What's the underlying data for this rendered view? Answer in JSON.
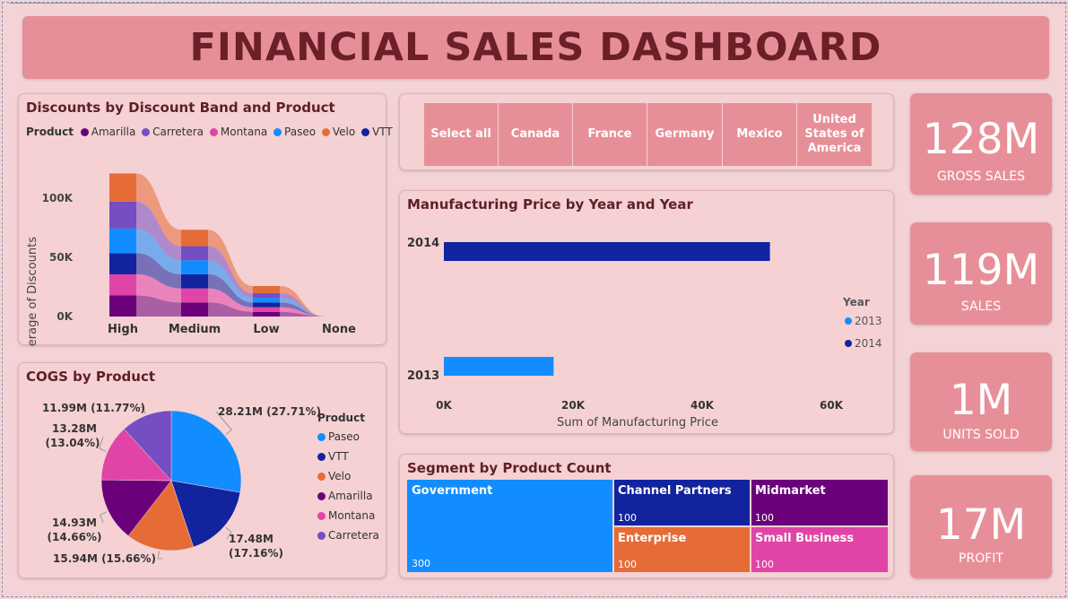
{
  "header": {
    "title": "FINANCIAL SALES DASHBOARD"
  },
  "colors": {
    "Paseo": "#118dff",
    "VTT": "#12239e",
    "Velo": "#e66c37",
    "Amarilla": "#6b007b",
    "Montana": "#e044a7",
    "Carretera": "#744ec2"
  },
  "discounts": {
    "title": "Discounts by Discount Band and Product",
    "legend_title": "Product",
    "legend": [
      "Amarilla",
      "Carretera",
      "Montana",
      "Paseo",
      "Velo",
      "VTT"
    ],
    "ylabel": "Average of Discounts",
    "yticks": [
      "0K",
      "50K",
      "100K"
    ],
    "categories": [
      "High",
      "Medium",
      "Low",
      "None"
    ]
  },
  "cogs": {
    "title": "COGS by Product",
    "legend_title": "Product",
    "legend": [
      "Paseo",
      "VTT",
      "Velo",
      "Amarilla",
      "Montana",
      "Carretera"
    ],
    "labels": {
      "paseo": "28.21M (27.71%)",
      "vtt_value": "17.48M",
      "vtt_pct": "(17.16%)",
      "velo": "15.94M (15.66%)",
      "amarilla_value": "14.93M",
      "amarilla_pct": "(14.66%)",
      "montana_value": "13.28M",
      "montana_pct": "(13.04%)",
      "carretera": "11.99M (11.77%)"
    }
  },
  "slicer": {
    "items": [
      "Select all",
      "Canada",
      "France",
      "Germany",
      "Mexico",
      "United States of America"
    ]
  },
  "manufacturing": {
    "title": "Manufacturing Price by Year and Year",
    "xlabel": "Sum of Manufacturing Price",
    "xticks": [
      "0K",
      "20K",
      "40K",
      "60K"
    ],
    "legend_title": "Year",
    "legend": [
      "2013",
      "2014"
    ],
    "years": [
      "2014",
      "2013"
    ]
  },
  "segment": {
    "title": "Segment by Product Count",
    "tiles": [
      {
        "name": "Government",
        "count": "300"
      },
      {
        "name": "Channel Partners",
        "count": "100"
      },
      {
        "name": "Midmarket",
        "count": "100"
      },
      {
        "name": "Enterprise",
        "count": "100"
      },
      {
        "name": "Small Business",
        "count": "100"
      }
    ]
  },
  "kpis": [
    {
      "value": "128M",
      "label": "GROSS SALES"
    },
    {
      "value": "119M",
      "label": "SALES"
    },
    {
      "value": "1M",
      "label": "UNITS SOLD"
    },
    {
      "value": "17M",
      "label": "PROFIT"
    }
  ],
  "chart_data": [
    {
      "type": "area",
      "title": "Discounts by Discount Band and Product",
      "ylabel": "Average of Discounts",
      "categories": [
        "High",
        "Medium",
        "Low",
        "None"
      ],
      "ylim": [
        0,
        130000
      ],
      "series": [
        {
          "name": "Amarilla",
          "values": [
            18000,
            12000,
            4000,
            0
          ]
        },
        {
          "name": "Montana",
          "values": [
            18000,
            12000,
            4000,
            0
          ]
        },
        {
          "name": "VTT",
          "values": [
            18000,
            12000,
            4000,
            0
          ]
        },
        {
          "name": "Paseo",
          "values": [
            21000,
            12000,
            4000,
            0
          ]
        },
        {
          "name": "Carretera",
          "values": [
            23000,
            12000,
            4000,
            0
          ]
        },
        {
          "name": "Velo",
          "values": [
            24000,
            14000,
            6000,
            0
          ]
        }
      ]
    },
    {
      "type": "pie",
      "title": "COGS by Product",
      "categories": [
        "Paseo",
        "VTT",
        "Velo",
        "Amarilla",
        "Montana",
        "Carretera"
      ],
      "values": [
        28.21,
        17.48,
        15.94,
        14.93,
        13.28,
        11.99
      ],
      "percent": [
        27.71,
        17.16,
        15.66,
        14.66,
        13.04,
        11.77
      ]
    },
    {
      "type": "bar",
      "title": "Manufacturing Price by Year and Year",
      "categories": [
        "2014",
        "2013"
      ],
      "series": [
        {
          "name": "2014",
          "values": [
            50500,
            0
          ]
        },
        {
          "name": "2013",
          "values": [
            0,
            17000
          ]
        }
      ],
      "xlim": [
        0,
        60000
      ],
      "xlabel": "Sum of Manufacturing Price"
    },
    {
      "type": "table",
      "title": "Segment by Product Count",
      "categories": [
        "Government",
        "Channel Partners",
        "Midmarket",
        "Enterprise",
        "Small Business"
      ],
      "values": [
        300,
        100,
        100,
        100,
        100
      ]
    }
  ]
}
